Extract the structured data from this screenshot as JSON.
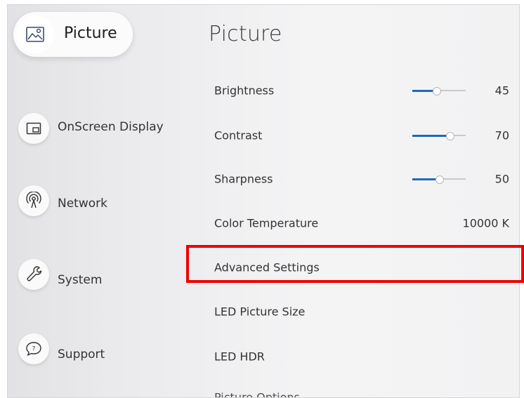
{
  "sidebar": {
    "items": [
      {
        "label": "Picture",
        "icon": "picture-icon",
        "selected": true
      },
      {
        "label": "OnScreen Display",
        "icon": "onscreen-display-icon",
        "selected": false
      },
      {
        "label": "Network",
        "icon": "network-icon",
        "selected": false
      },
      {
        "label": "System",
        "icon": "system-wrench-icon",
        "selected": false
      },
      {
        "label": "Support",
        "icon": "support-icon",
        "selected": false
      }
    ]
  },
  "main": {
    "title": "Picture",
    "settings": [
      {
        "label": "Brightness",
        "value": "45",
        "slider_level": 0.45
      },
      {
        "label": "Contrast",
        "value": "70",
        "slider_level": 0.7
      },
      {
        "label": "Sharpness",
        "value": "50",
        "slider_level": 0.5
      },
      {
        "label": "Color Temperature",
        "value": "10000 K"
      },
      {
        "label": "Advanced Settings",
        "highlighted": true
      },
      {
        "label": "LED Picture Size"
      },
      {
        "label": "LED HDR"
      },
      {
        "label": "Picture Options"
      }
    ]
  },
  "colors": {
    "slider_fill": "#1f69b8",
    "highlight_border": "#ee0000"
  }
}
